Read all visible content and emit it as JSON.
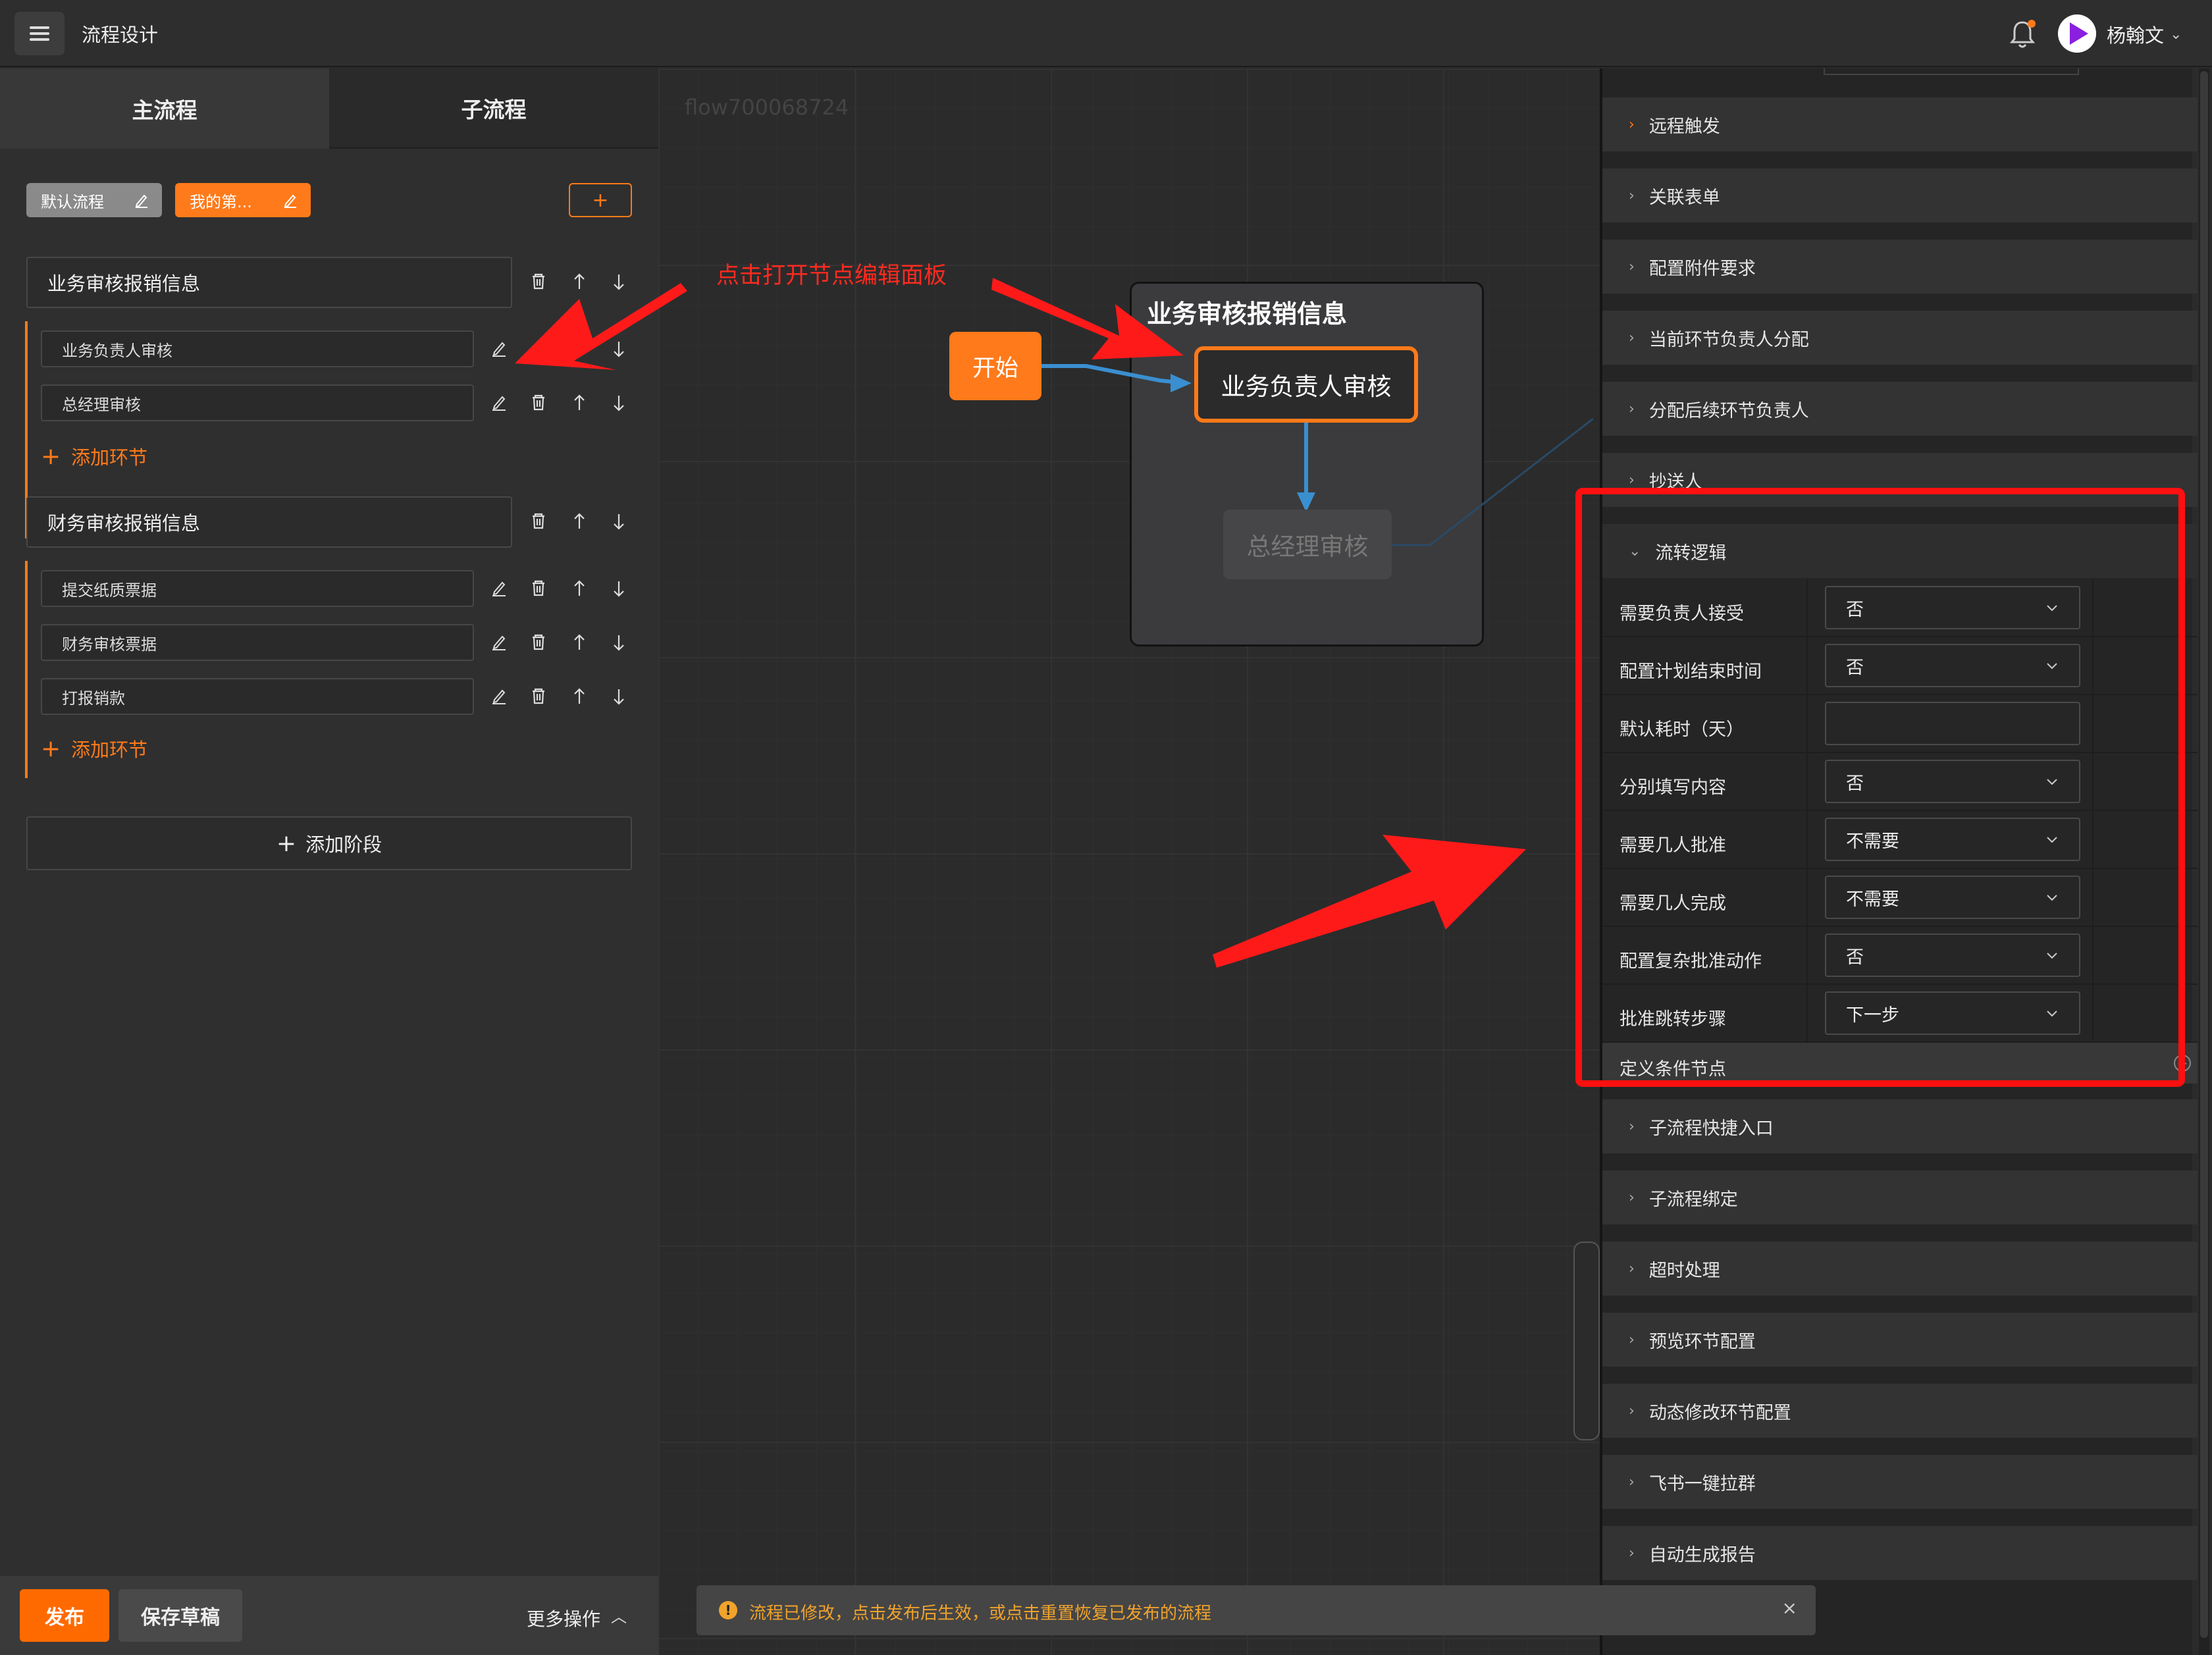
{
  "app": {
    "title": "流程设计",
    "user": "杨翰文"
  },
  "tabs": {
    "main": "主流程",
    "sub": "子流程"
  },
  "flows": [
    {
      "label": "默认流程",
      "active": false
    },
    {
      "label": "我的第...",
      "active": true
    }
  ],
  "add_flow_label": "+",
  "stages": [
    {
      "title": "业务审核报销信息",
      "nodes": [
        "业务负责人审核",
        "总经理审核"
      ]
    },
    {
      "title": "财务审核报销信息",
      "nodes": [
        "提交纸质票据",
        "财务审核票据",
        "打报销款"
      ]
    }
  ],
  "add_node_label": "添加环节",
  "add_stage_label": "添加阶段",
  "bottom": {
    "publish": "发布",
    "save_draft": "保存草稿",
    "more": "更多操作"
  },
  "canvas": {
    "flow_id": "flow700068724",
    "group_title": "业务审核报销信息",
    "start": "开始",
    "node_active": "业务负责人审核",
    "node_next": "总经理审核",
    "annotation": "点击打开节点编辑面板"
  },
  "toast": {
    "icon": "!",
    "text": "流程已修改，点击发布后生效，或点击重置恢复已发布的流程",
    "close": "×"
  },
  "panel": {
    "sections_top": [
      "远程触发",
      "关联表单",
      "配置附件要求",
      "当前环节负责人分配",
      "分配后续环节负责人",
      "抄送人"
    ],
    "expanded_title": "流转逻辑",
    "fields": [
      {
        "label": "需要负责人接受",
        "value": "否",
        "type": "select"
      },
      {
        "label": "配置计划结束时间",
        "value": "否",
        "type": "select"
      },
      {
        "label": "默认耗时（天）",
        "value": "",
        "type": "input"
      },
      {
        "label": "分别填写内容",
        "value": "否",
        "type": "select"
      },
      {
        "label": "需要几人批准",
        "value": "不需要",
        "type": "select"
      },
      {
        "label": "需要几人完成",
        "value": "不需要",
        "type": "select"
      },
      {
        "label": "配置复杂批准动作",
        "value": "否",
        "type": "select"
      },
      {
        "label": "批准跳转步骤",
        "value": "下一步",
        "type": "select"
      }
    ],
    "condition_label": "定义条件节点",
    "sections_bottom": [
      "子流程快捷入口",
      "子流程绑定",
      "超时处理",
      "预览环节配置",
      "动态修改环节配置",
      "飞书一键拉群",
      "自动生成报告"
    ]
  },
  "colors": {
    "accent": "#ff7a1a",
    "annotation": "#ff2a1f",
    "edge": "#3a8fd0",
    "warning": "#f1a32b"
  }
}
